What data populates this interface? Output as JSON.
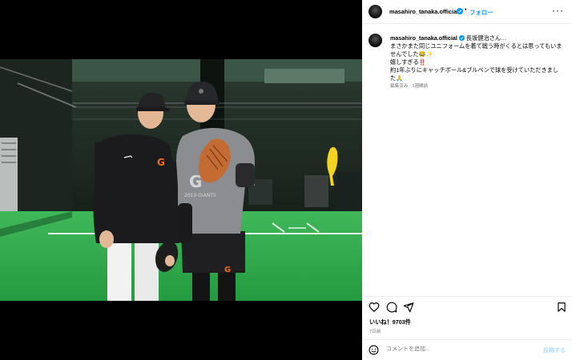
{
  "post": {
    "username": "masahiro_tanaka.official",
    "dot": "•",
    "follow_label": "フォロー",
    "more_label": "···",
    "caption_lines": [
      "長坂健治さん…",
      "まさかまた同じユニフォームを着て戦う時がくるとは思ってもいま",
      "せんでした😂✨",
      "嬉しすぎる‼️",
      "約1年ぶりにキャッチボール&ブルペンで球を受けていただきまし",
      "た🙏"
    ],
    "meta": "編集済み · 1週間前",
    "likes": "いいね！9703件",
    "ago": "7日前",
    "comment_placeholder": "コメントを追加...",
    "post_label": "投稿する"
  },
  "photo": {
    "left_cap_logo": "G",
    "right_shirt_logo": "G",
    "right_shirt_text": "2019 GIANTS",
    "right_shorts_logo": "G"
  },
  "icons": {
    "verified": "verified-badge-icon",
    "like": "heart-icon",
    "comment": "comment-icon",
    "share": "share-icon",
    "save": "bookmark-icon",
    "emoji": "emoji-icon",
    "more": "more-icon"
  },
  "colors": {
    "accent": "#0095f6",
    "muted": "#737373",
    "turf": "#2ea44a"
  }
}
